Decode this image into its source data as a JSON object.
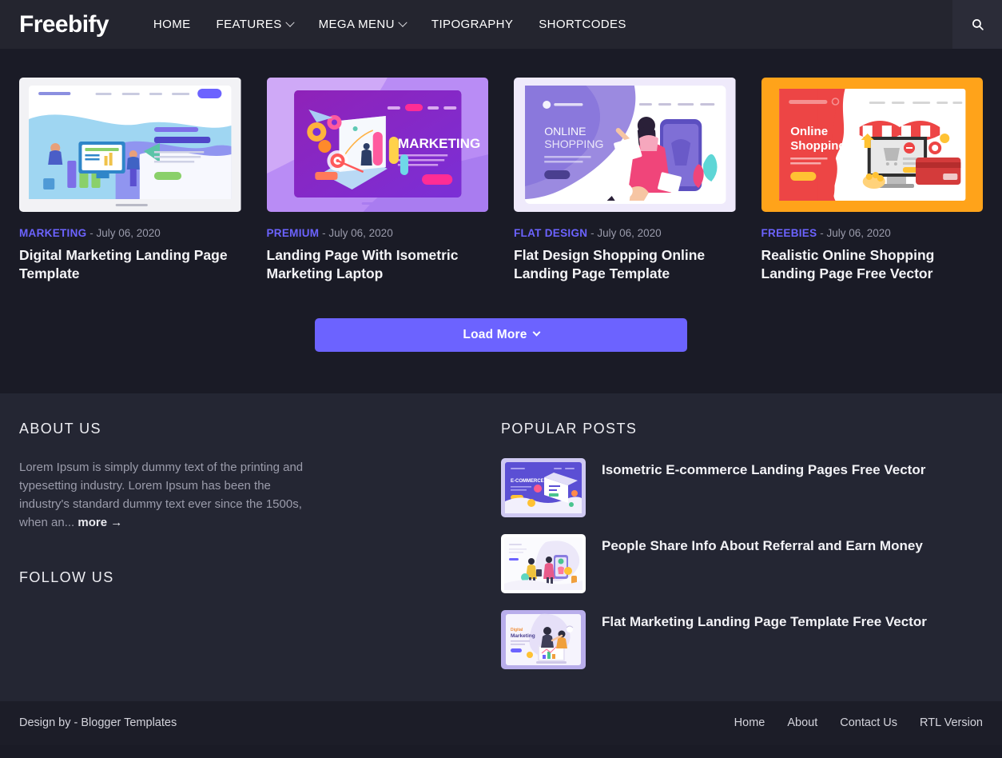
{
  "header": {
    "brand": "Freebify",
    "nav": [
      {
        "label": "HOME",
        "has_dropdown": false
      },
      {
        "label": "FEATURES",
        "has_dropdown": true
      },
      {
        "label": "MEGA MENU",
        "has_dropdown": true
      },
      {
        "label": "TIPOGRAPHY",
        "has_dropdown": false
      },
      {
        "label": "SHORTCODES",
        "has_dropdown": false
      }
    ],
    "search_icon": "search-icon"
  },
  "posts": [
    {
      "category": "MARKETING",
      "separator": "-",
      "date": "July 06, 2020",
      "title": "Digital Marketing Landing Page Template",
      "thumb_alt": "digital-marketing-landing-page-preview"
    },
    {
      "category": "PREMIUM",
      "separator": "-",
      "date": "July 06, 2020",
      "title": "Landing Page With Isometric Marketing Laptop",
      "thumb_alt": "isometric-marketing-laptop-preview"
    },
    {
      "category": "FLAT DESIGN",
      "separator": "-",
      "date": "July 06, 2020",
      "title": "Flat Design Shopping Online Landing Page Template",
      "thumb_alt": "online-shopping-flat-preview"
    },
    {
      "category": "FREEBIES",
      "separator": "-",
      "date": "July 06, 2020",
      "title": "Realistic Online Shopping Landing Page Free Vector",
      "thumb_alt": "realistic-online-shopping-preview"
    }
  ],
  "load_more": {
    "label": "Load More",
    "icon": "chevron-down-icon"
  },
  "about": {
    "title": "ABOUT US",
    "body": "Lorem Ipsum is simply dummy text of the printing and typesetting industry. Lorem Ipsum has been the industry's standard dummy text ever since the 1500s, when an...",
    "more_label": "more →"
  },
  "follow": {
    "title": "FOLLOW US"
  },
  "popular": {
    "title": "POPULAR POSTS",
    "items": [
      {
        "title": "Isometric E-commerce Landing Pages Free Vector",
        "thumb_alt": "ecommerce-isometric-thumb"
      },
      {
        "title": "People Share Info About Referral and Earn Money",
        "thumb_alt": "referral-share-thumb"
      },
      {
        "title": "Flat Marketing Landing Page Template Free Vector",
        "thumb_alt": "flat-marketing-thumb"
      }
    ]
  },
  "footer": {
    "credit_prefix": "Design by - ",
    "credit_link": "Blogger Templates",
    "links": [
      "Home",
      "About",
      "Contact Us",
      "RTL Version"
    ]
  },
  "colors": {
    "accent": "#6c63ff",
    "header_bg": "#24252f",
    "page_bg": "#1a1b26",
    "widget_bg": "#242633",
    "footer_bg": "#1c1d28"
  }
}
